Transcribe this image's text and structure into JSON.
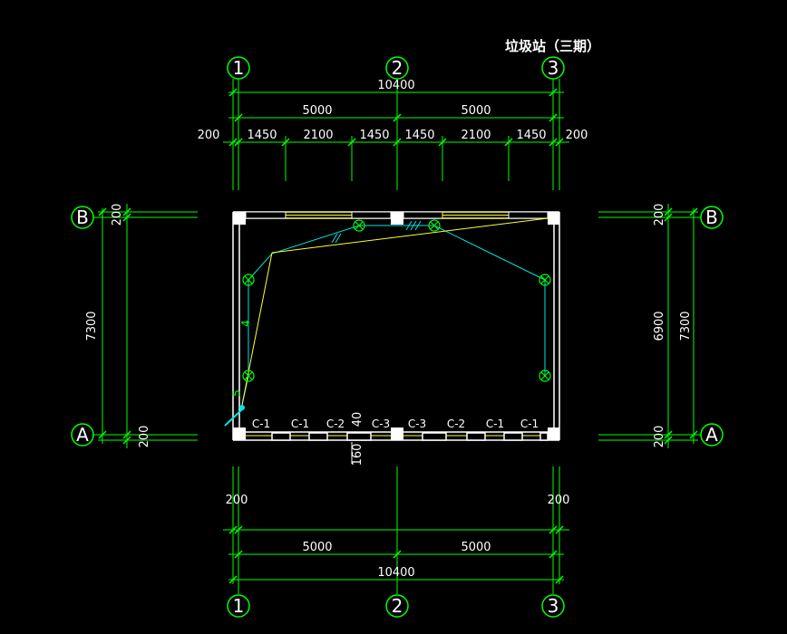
{
  "title": "垃圾站（三期）",
  "axes": {
    "columns": [
      "1",
      "2",
      "3"
    ],
    "rows": [
      "B",
      "A"
    ]
  },
  "dims_top": {
    "total": "10400",
    "spans": [
      "5000",
      "5000"
    ],
    "left_offset": "200",
    "right_offset": "200",
    "segments": [
      "1450",
      "2100",
      "1450",
      "1450",
      "2100",
      "1450"
    ]
  },
  "dims_bottom": {
    "left_offset": "200",
    "right_offset": "200",
    "spans": [
      "5000",
      "5000"
    ],
    "total": "10400"
  },
  "dims_left": {
    "total": "7300",
    "top_offset": "200",
    "bottom_offset": "200"
  },
  "dims_right": {
    "total": "7300",
    "inner": "6900",
    "top_offset": "200",
    "bottom_offset": "200"
  },
  "windows": [
    "C-1",
    "C-1",
    "C-2",
    "C-3",
    "C-3",
    "C-2",
    "C-1",
    "C-1"
  ],
  "misc": {
    "small_40": "40",
    "small_160": "160",
    "wire_label_4": "4",
    "wire_label_5": "5"
  },
  "colors": {
    "dimension": "#00ff00",
    "wall": "#ffffff",
    "wire": "#00e5e5",
    "yellow": "#ffff33"
  }
}
